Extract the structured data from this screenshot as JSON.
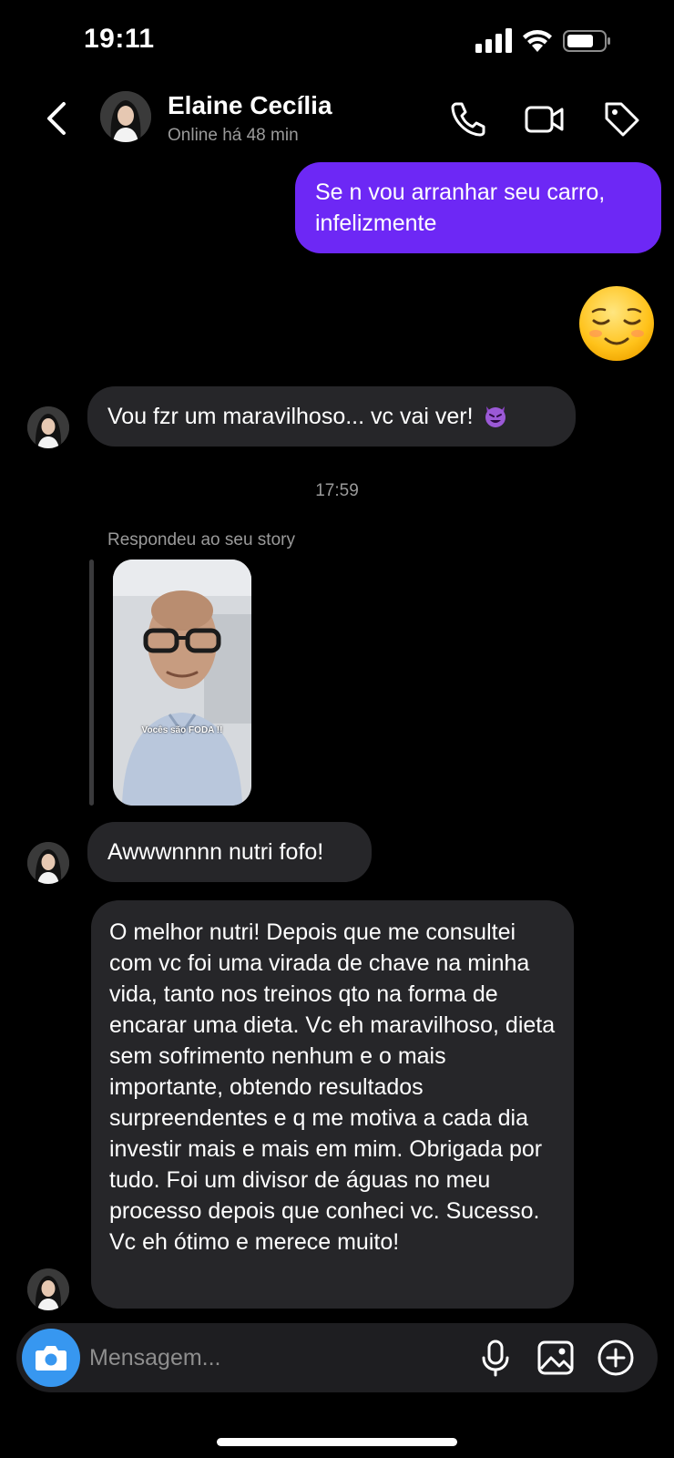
{
  "status_bar": {
    "time": "19:11"
  },
  "header": {
    "contact_name": "Elaine Cecília",
    "contact_status": "Online há 48 min",
    "icons": [
      "chevron-left-icon",
      "phone-icon",
      "video-camera-icon",
      "tag-icon"
    ]
  },
  "messages": {
    "outgoing_1": "Se n vou arranhar seu carro, infelizmente",
    "outgoing_emoji": "relieved-face-emoji",
    "incoming_1": "Vou fzr um maravilhoso... vc vai ver!",
    "incoming_1_emoji": "smiling-devil-emoji",
    "timestamp": "17:59",
    "reply_label": "Respondeu ao seu story",
    "story_caption": "Vocês são FODA !!",
    "incoming_2": "Awwwnnnn nutri fofo!",
    "incoming_3": "O melhor nutri! Depois que me consultei com vc foi uma virada de chave na minha vida, tanto nos treinos qto na forma de encarar uma dieta. Vc eh maravilhoso, dieta sem sofrimento nenhum e o mais importante, obtendo resultados surpreendentes e q me motiva a cada dia investir mais e mais em mim. Obrigada por tudo. Foi um divisor de águas no meu processo depois que conheci vc. Sucesso. Vc eh ótimo e merece muito!"
  },
  "composer": {
    "placeholder": "Mensagem...",
    "icons": [
      "camera-icon",
      "microphone-icon",
      "gallery-icon",
      "plus-circle-icon"
    ]
  },
  "colors": {
    "background": "#000000",
    "outgoing_bubble": "#6d28f5",
    "incoming_bubble": "#262629",
    "camera_button": "#3797f0",
    "secondary_text": "#9a9a9a"
  }
}
